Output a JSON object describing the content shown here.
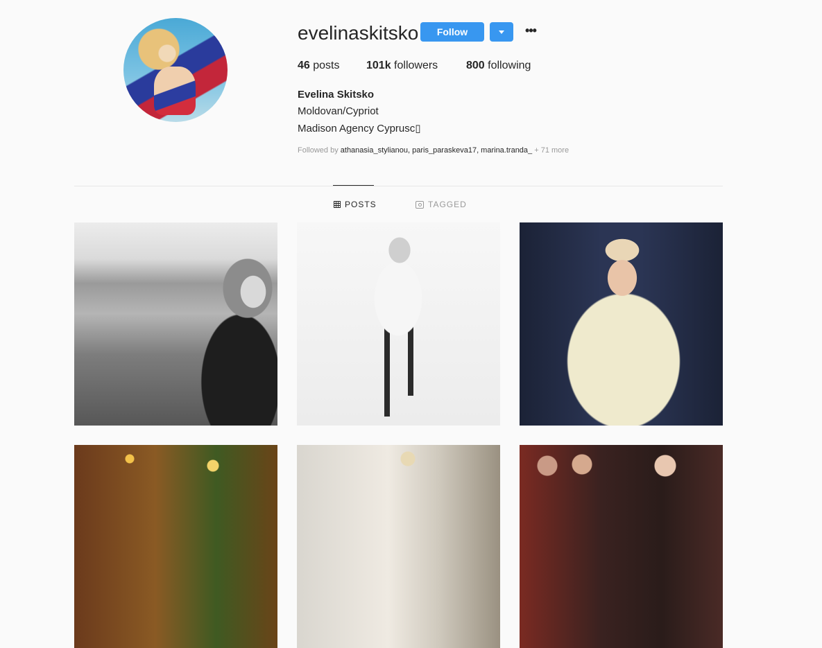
{
  "profile": {
    "username": "evelinaskitsko",
    "follow_label": "Follow",
    "more_label": "•••",
    "stats": {
      "posts_count": "46",
      "posts_label": "posts",
      "followers_count": "101k",
      "followers_label": "followers",
      "following_count": "800",
      "following_label": "following"
    },
    "full_name": "Evelina Skitsko",
    "bio": [
      "Moldovan/Cypriot",
      "Madison Agency Cyprusc▯"
    ],
    "followed_by": {
      "prefix": "Followed by",
      "names": "athanasia_stylianou, paris_paraskeva17, marina.tranda_",
      "more": "+ 71 more"
    }
  },
  "tabs": [
    {
      "label": "POSTS",
      "icon": "grid-icon",
      "active": true
    },
    {
      "label": "TAGGED",
      "icon": "tag-icon",
      "active": false
    }
  ],
  "colors": {
    "accent": "#3897f0",
    "text": "#262626",
    "muted": "#999999",
    "background": "#fafafa"
  }
}
